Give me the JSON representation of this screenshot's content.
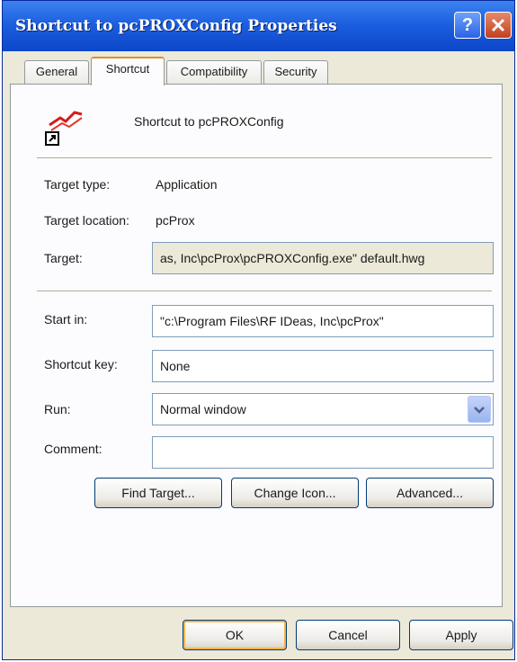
{
  "window": {
    "title": "Shortcut to pcPROXConfig Properties"
  },
  "tabs": [
    {
      "label": "General",
      "active": false
    },
    {
      "label": "Shortcut",
      "active": true
    },
    {
      "label": "Compatibility",
      "active": false
    },
    {
      "label": "Security",
      "active": false
    }
  ],
  "shortcut": {
    "icon": "app-shortcut-icon",
    "name": "Shortcut to pcPROXConfig",
    "target_type_label": "Target type:",
    "target_type_value": "Application",
    "target_location_label": "Target location:",
    "target_location_value": "pcProx",
    "target_label": "Target:",
    "target_value": "as, Inc\\pcProx\\pcPROXConfig.exe\" default.hwg",
    "start_in_label": "Start in:",
    "start_in_value": "\"c:\\Program Files\\RF IDeas, Inc\\pcProx\"",
    "shortcut_key_label": "Shortcut key:",
    "shortcut_key_value": "None",
    "run_label": "Run:",
    "run_value": "Normal window",
    "comment_label": "Comment:",
    "comment_value": "",
    "find_target_label": "Find Target...",
    "change_icon_label": "Change Icon...",
    "advanced_label": "Advanced..."
  },
  "footer": {
    "ok_label": "OK",
    "cancel_label": "Cancel",
    "apply_label": "Apply"
  },
  "colors": {
    "titlebar": "#1c5fe0",
    "dialog": "#ece9d8",
    "panel": "#fcfcfe",
    "focus": "#f8b34f"
  }
}
